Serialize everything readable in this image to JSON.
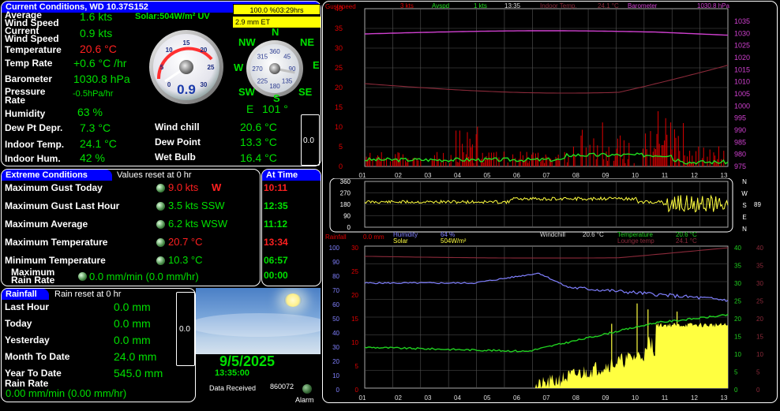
{
  "current": {
    "title": "Current Conditions, WD 10.37S152",
    "solar_uv": "Solar:504W/m² UV",
    "avg_wind_label_1": "Average",
    "avg_wind_label_2": "Wind Speed",
    "avg_wind_value": "1.6 kts",
    "cur_wind_label_1": "Current",
    "cur_wind_label_2": "Wind Speed",
    "cur_wind_value": "0.9 kts",
    "temp_label": "Temperature",
    "temp_value": "20.6 °C",
    "temp_rate_label": "Temp Rate",
    "temp_rate_value": "+0.6 °C /hr",
    "baro_label": "Barometer",
    "baro_value": "1030.8 hPa",
    "press_rate_label_1": "Pressure",
    "press_rate_label_2": "Rate",
    "press_rate_value": "-0.5hPa/hr",
    "humidity_label": "Humidity",
    "humidity_value": "63 %",
    "dewdep_label": "Dew Pt Depr.",
    "dewdep_value": "7.3 °C",
    "indoor_temp_label": "Indoor Temp.",
    "indoor_temp_value": "24.1 °C",
    "indoor_hum_label": "Indoor Hum.",
    "indoor_hum_value": "42 %",
    "windchill_label": "Wind chill",
    "windchill_value": "20.6 °C",
    "dewpoint_label": "Dew Point",
    "dewpoint_value": "13.3 °C",
    "wetbulb_label": "Wet Bulb",
    "wetbulb_value": "16.4 °C",
    "side_gauge_value": "0.0"
  },
  "status_boxes": {
    "percent": "100.0 %03:29hrs",
    "et": "2.9 mm ET"
  },
  "speed_gauge": {
    "value": "0.9",
    "ticks": [
      "0",
      "5",
      "10",
      "15",
      "20",
      "25",
      "30"
    ]
  },
  "compass": {
    "N": "N",
    "NE": "NE",
    "E": "E",
    "SE": "SE",
    "S": "S",
    "SW": "SW",
    "W": "W",
    "NW": "NW",
    "ring": [
      "360",
      "45",
      "90",
      "135",
      "180",
      "225",
      "270",
      "315"
    ],
    "direction": "E",
    "degrees": "101 °",
    "direction_deg": 101
  },
  "extremes": {
    "title": "Extreme Conditions",
    "reset_note": "Values reset at 0 hr",
    "at_time_title": "At Time",
    "rows": [
      {
        "label": "Maximum Gust Today",
        "value": "9.0 kts",
        "suffix": "W",
        "time": "10:11",
        "red": true
      },
      {
        "label": "Maximum Gust Last Hour",
        "value": "3.5 kts SSW",
        "suffix": "",
        "time": "12:35",
        "red": false
      },
      {
        "label": "Maximum Average",
        "value": "6.2 kts WSW",
        "suffix": "",
        "time": "11:12",
        "red": false
      },
      {
        "label": "Maximum Temperature",
        "value": "20.7 °C",
        "suffix": "",
        "time": "13:34",
        "red": true
      },
      {
        "label": "Minimum Temperature",
        "value": "10.3 °C",
        "suffix": "",
        "time": "06:57",
        "red": false
      }
    ],
    "max_rain_label_1": "Maximum",
    "max_rain_label_2": "Rain Rate",
    "max_rain_value": "0.0 mm/min (0.0 mm/hr)",
    "max_rain_time": "00:00"
  },
  "rainfall": {
    "title": "Rainfall",
    "reset_note": "Rain reset at 0 hr",
    "rows": [
      {
        "label": "Last Hour",
        "value": "0.0 mm"
      },
      {
        "label": "Today",
        "value": "0.0 mm"
      },
      {
        "label": "Yesterday",
        "value": "0.0 mm"
      },
      {
        "label": "Month To Date",
        "value": "24.0 mm"
      },
      {
        "label": "Year To Date",
        "value": "545.0 mm"
      }
    ],
    "rate_label": "Rain Rate",
    "rate_value": "0.00 mm/min (0.00 mm/hr)",
    "gauge_value": "0.0"
  },
  "sky": {
    "date": "9/5/2025",
    "time": "13:35:00",
    "data_received_label": "Data Received",
    "data_received_value": "860072",
    "alarm_label": "Alarm"
  },
  "graph_top": {
    "legend": {
      "gust_label": "Gustspeed",
      "gust_value": "3 kts",
      "avg_label": "Avspd",
      "avg_value": "1 kts",
      "time": "13:35",
      "indoor_label": "Indoor Temp.",
      "indoor_value": "24.1 °C",
      "baro_label": "Barometer",
      "baro_value": "1030.8 hPa"
    },
    "left_ticks": [
      "40",
      "35",
      "30",
      "25",
      "20",
      "15",
      "10",
      "5",
      "0"
    ],
    "right_ticks": [
      "1035",
      "1030",
      "1025",
      "1020",
      "1015",
      "1010",
      "1005",
      "1000",
      "995",
      "990",
      "985",
      "980",
      "975"
    ],
    "x_ticks": [
      "01",
      "02",
      "03",
      "04",
      "05",
      "06",
      "07",
      "08",
      "09",
      "10",
      "11",
      "12",
      "13"
    ]
  },
  "graph_mid": {
    "left_ticks": [
      "360",
      "270",
      "180",
      "90",
      "0"
    ],
    "compass_letters": [
      "N",
      "W",
      "S",
      "E",
      "N"
    ],
    "direction_value": "89"
  },
  "graph_bot": {
    "legend": {
      "rain_label": "Rainfall",
      "rain_value": "0.0 mm",
      "humidity_label": "Humidity",
      "humidity_value": "64 %",
      "solar_label": "Solar",
      "solar_value": "504W/m²",
      "windchill_label": "Windchill",
      "windchill_value": "20.6 °C",
      "temp_label": "Temperature",
      "temp_value": "20.6 °C",
      "lounge_label": "Lounge temp",
      "lounge_value": "24.1 °C"
    },
    "left_ticks_hum": [
      "100",
      "90",
      "80",
      "70",
      "60",
      "50",
      "40",
      "30",
      "20",
      "10",
      "0"
    ],
    "left_ticks_rain": [
      "30",
      "25",
      "20",
      "15",
      "10",
      "5",
      "0"
    ],
    "right_ticks_temp": [
      "40",
      "35",
      "30",
      "25",
      "20",
      "15",
      "10",
      "5",
      "0"
    ],
    "right_ticks_temp2": [
      "40",
      "35",
      "30",
      "25",
      "20",
      "15",
      "10",
      "5",
      "0"
    ],
    "x_ticks": [
      "01",
      "02",
      "03",
      "04",
      "05",
      "06",
      "07",
      "08",
      "09",
      "10",
      "11",
      "12",
      "13"
    ]
  },
  "colors": {
    "header_bg": "#0000ff",
    "value_green": "#00e000",
    "value_red": "#ff2020",
    "status_yellow": "#ffff00",
    "gust_red": "#e00000",
    "avg_green": "#20e020",
    "baro_magenta": "#d040d0",
    "indoor_maroon": "#8b2a3a",
    "dir_yellow": "#ffff40",
    "humidity_blue": "#8080ff",
    "solar_yellow": "#ffff40",
    "temp_green": "#20d020"
  }
}
